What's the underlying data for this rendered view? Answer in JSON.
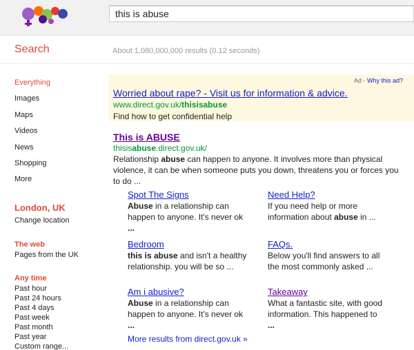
{
  "search": {
    "query": "this is abuse"
  },
  "header": {
    "heading": "Search",
    "stats": "About 1,080,000,000 results (0.12 seconds)"
  },
  "sidebar": {
    "items": [
      {
        "label": "Everything",
        "active": true
      },
      {
        "label": "Images"
      },
      {
        "label": "Maps"
      },
      {
        "label": "Videos"
      },
      {
        "label": "News"
      },
      {
        "label": "Shopping"
      },
      {
        "label": "More"
      }
    ],
    "location": "London, UK",
    "change_location": "Change location",
    "web_title": "The web",
    "web_items": [
      "Pages from the UK"
    ],
    "time_title": "Any time",
    "time_items": [
      "Past hour",
      "Past 24 hours",
      "Past 4 days",
      "Past week",
      "Past month",
      "Past year",
      "Custom range..."
    ]
  },
  "ad": {
    "label_prefix": "Ad - ",
    "why": "Why this ad?",
    "title": "Worried about rape? - Visit us for information & advice.",
    "url_prefix": "www.direct.gov.uk/",
    "url_bold": "thisisabuse",
    "desc": "Find how to get confidential help"
  },
  "result": {
    "title": "This is ABUSE",
    "url_prefix": "thisis",
    "url_bold": "abuse",
    "url_suffix": ".direct.gov.uk/",
    "snippet_pre": "Relationship ",
    "snippet_bold": "abuse",
    "snippet_post": " can happen to anyone. It involves more than physical violence, it can be when someone puts you down, threatens you or forces you to do ..."
  },
  "sitelinks": [
    {
      "title": "Spot The Signs",
      "bold": "Abuse",
      "desc": " in a relationship can happen to anyone. It's never ok",
      "tail": "..."
    },
    {
      "title": "Need Help?",
      "pre": "If you need help or more information about ",
      "bold": "abuse",
      "desc": " in ..."
    },
    {
      "title": "Bedroom",
      "bold": "this is abuse",
      "desc": " and isn't a healthy relationship. you will be so ..."
    },
    {
      "title": "FAQs.",
      "pre": "Below you'll find answers to all the most commonly asked ..."
    },
    {
      "title": "Am i abusive?",
      "bold": "Abuse",
      "desc": " in a relationship can happen to anyone. It's never ok",
      "tail": "..."
    },
    {
      "title": "Takeaway",
      "pre": "What a fantastic site, with good information. This happened to",
      "tail": "..."
    }
  ],
  "more_results": "More results from direct.gov.uk »",
  "colors": {
    "accent": "#dd4b39",
    "link": "#1122cc",
    "visited": "#660099",
    "url": "#009933",
    "ad_bg": "#fff8e0"
  }
}
